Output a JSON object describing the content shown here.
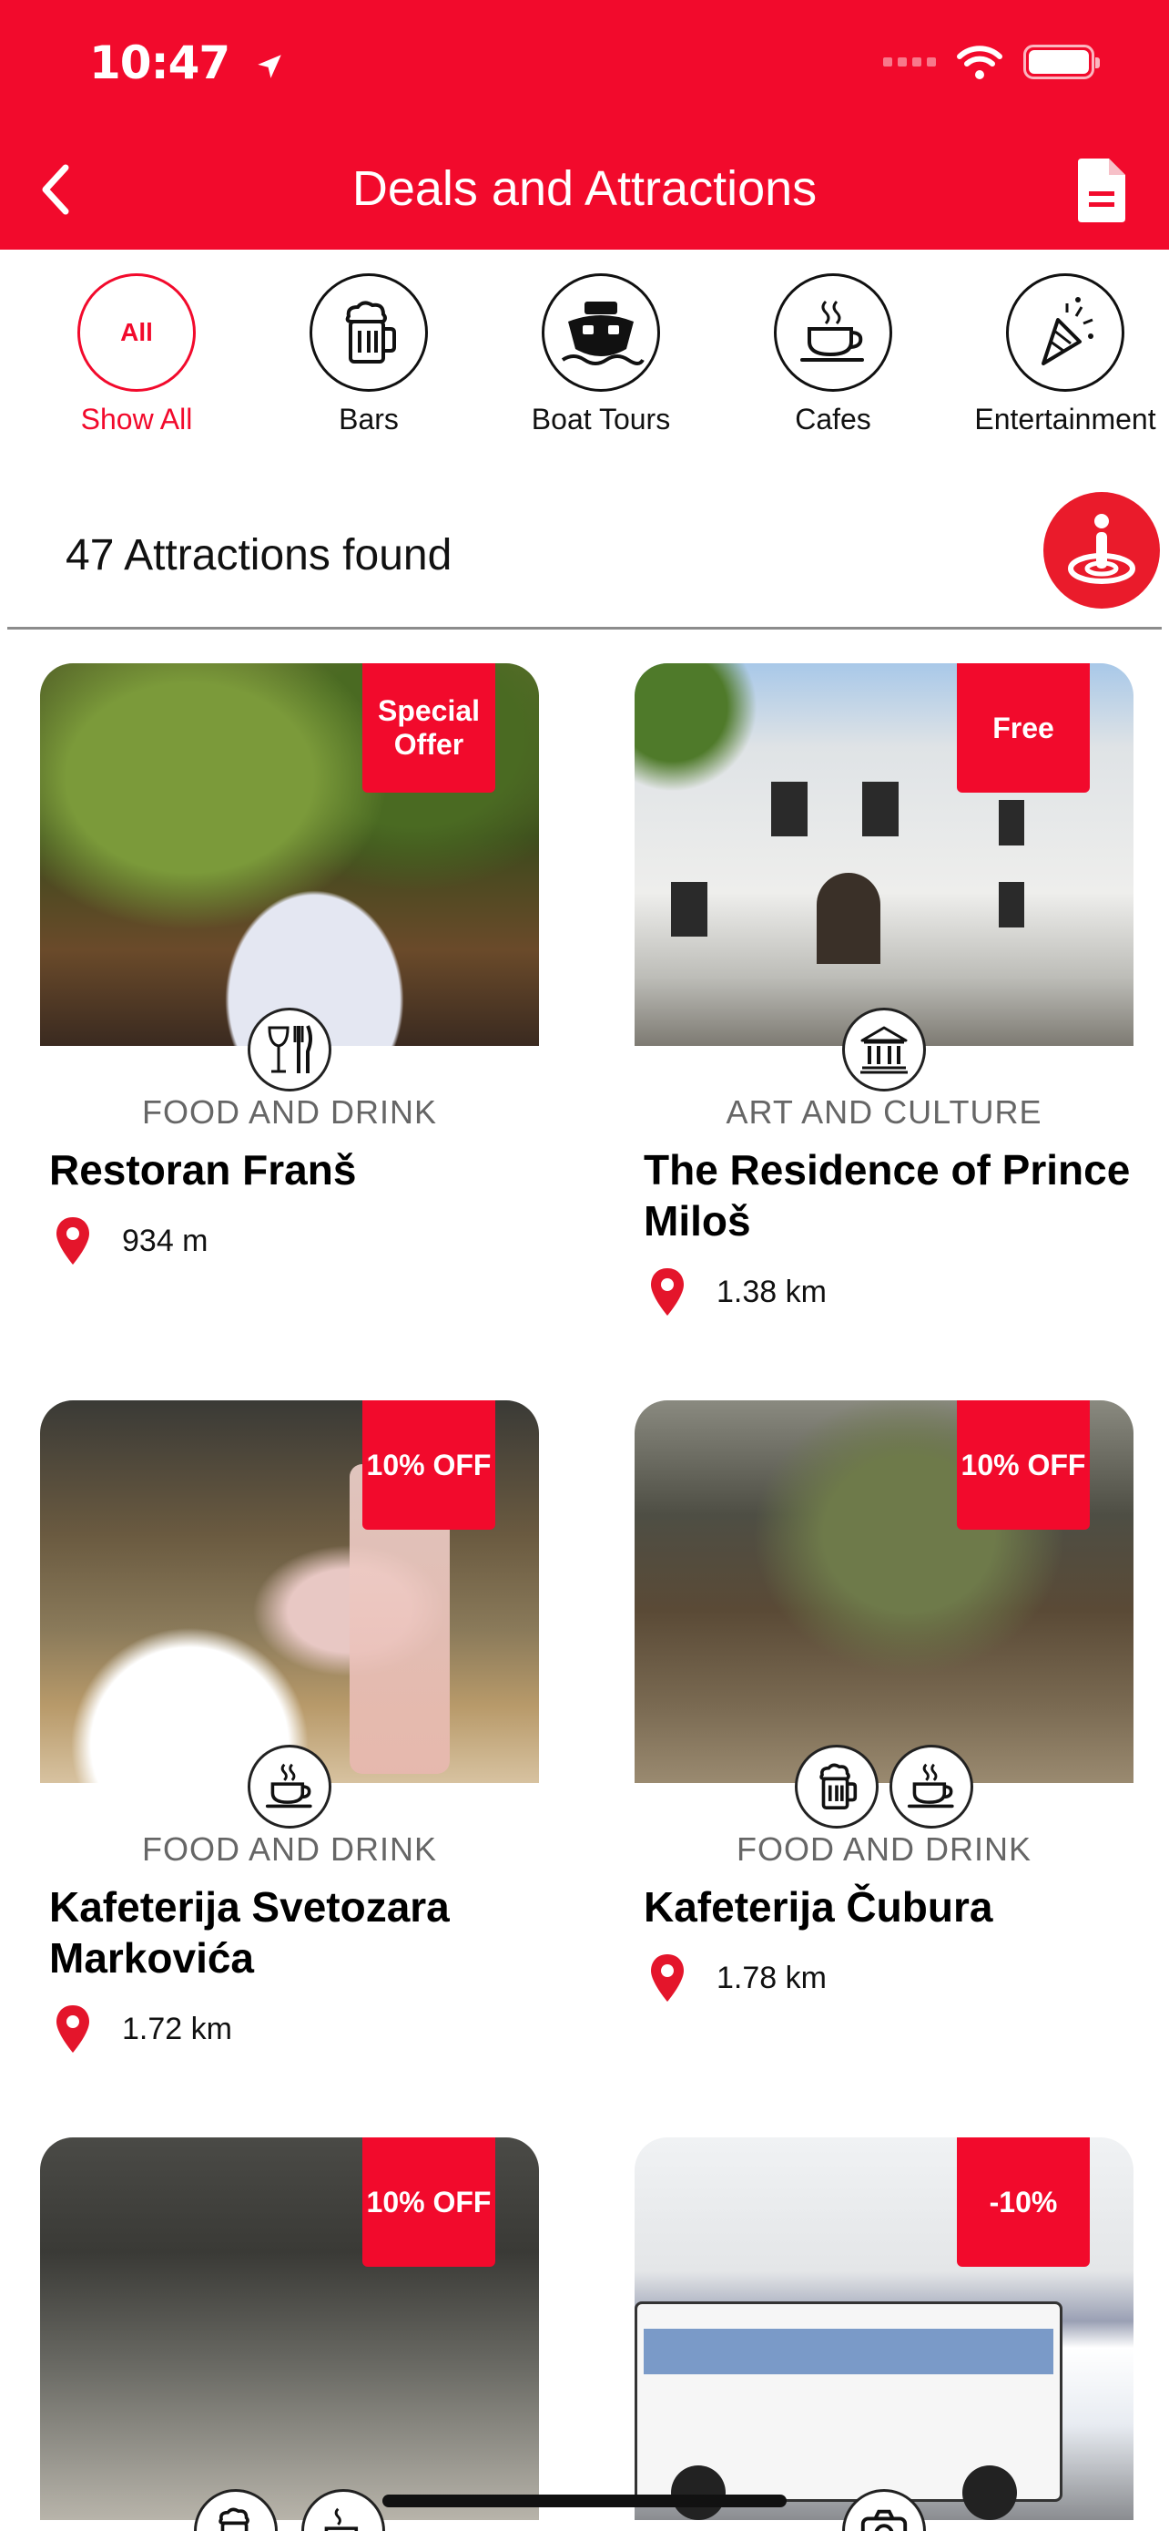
{
  "status": {
    "time": "10:47"
  },
  "header": {
    "title": "Deals and Attractions"
  },
  "categories": [
    {
      "icon_text": "All",
      "label": "Show All"
    },
    {
      "label": "Bars",
      "icon": "beer-icon"
    },
    {
      "label": "Boat Tours",
      "icon": "boat-icon"
    },
    {
      "label": "Cafes",
      "icon": "coffee-icon"
    },
    {
      "label": "Entertainment",
      "icon": "party-icon"
    }
  ],
  "results": {
    "count_text": "47 Attractions found"
  },
  "cards": [
    {
      "badge": "Special Offer",
      "category": "FOOD AND DRINK",
      "title": "Restoran Franš",
      "distance": "934 m",
      "icons": [
        "restaurant-icon"
      ]
    },
    {
      "badge": "Free",
      "category": "ART AND CULTURE",
      "title": "The Residence of Prince Miloš",
      "distance": "1.38 km",
      "icons": [
        "museum-icon"
      ]
    },
    {
      "badge": "10% OFF",
      "category": "FOOD AND DRINK",
      "title": "Kafeterija Svetozara Markovića",
      "distance": "1.72 km",
      "icons": [
        "coffee-icon"
      ]
    },
    {
      "badge": "10% OFF",
      "category": "FOOD AND DRINK",
      "title": "Kafeterija Čubura",
      "distance": "1.78 km",
      "icons": [
        "beer-icon",
        "coffee-icon"
      ]
    },
    {
      "badge": "10% OFF",
      "icons": [
        "beer-icon",
        "coffee-icon"
      ]
    },
    {
      "badge": "-10%",
      "icons": [
        "camera-icon"
      ]
    }
  ],
  "colors": {
    "brand": "#f20a2c",
    "pin": "#e4152b"
  }
}
